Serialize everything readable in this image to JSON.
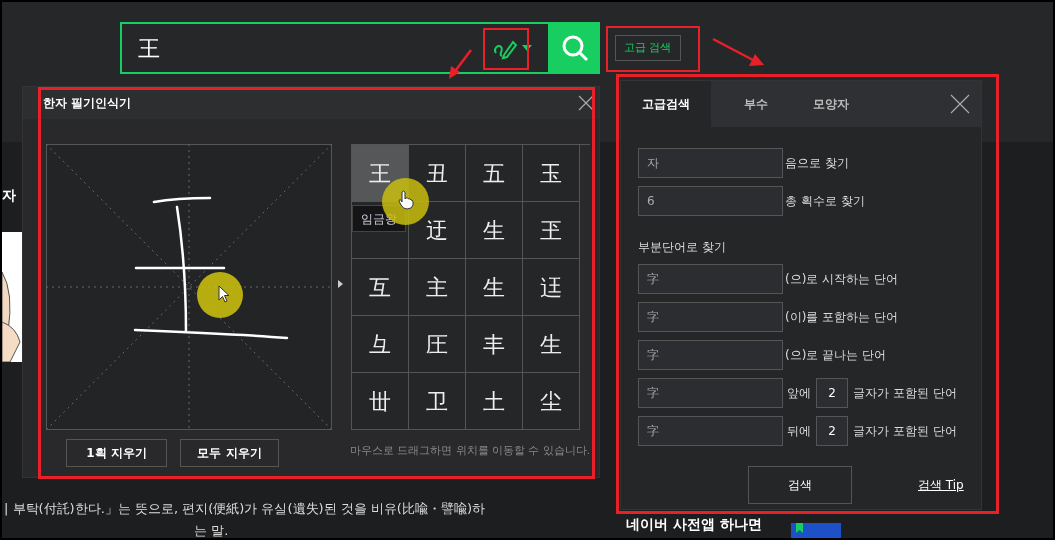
{
  "search": {
    "value": "王",
    "advanced_button": "고급 검색"
  },
  "background": {
    "left_label": "자",
    "description": [
      "| 부탁(付託)한다.」는 뜻으로, 편지(便紙)가 유실(遺失)된 것을 비유(比喩・譬喩)하",
      "는 말."
    ],
    "promo": "네이버 사전앱 하나면"
  },
  "handwriting": {
    "title": "한자 필기인식기",
    "candidates": [
      {
        "char": "王",
        "selected": true
      },
      {
        "char": "丑",
        "selected": false
      },
      {
        "char": "五",
        "selected": false
      },
      {
        "char": "玉",
        "selected": false
      },
      {
        "selected": false
      },
      {
        "char": "迂",
        "selected": false
      },
      {
        "char": "生",
        "selected": false
      },
      {
        "char": "玊",
        "selected": false
      },
      {
        "char": "互",
        "selected": false
      },
      {
        "char": "主",
        "selected": false
      },
      {
        "char": "生",
        "selected": false
      },
      {
        "char": "迋",
        "selected": false
      },
      {
        "char": "彑",
        "selected": false
      },
      {
        "char": "圧",
        "selected": false
      },
      {
        "char": "丰",
        "selected": false
      },
      {
        "char": "生",
        "selected": false
      },
      {
        "char": "丗",
        "selected": false
      },
      {
        "char": "卫",
        "selected": false
      },
      {
        "char": "土",
        "selected": false
      },
      {
        "char": "尘",
        "selected": false
      }
    ],
    "tooltip": "임금왕",
    "buttons": [
      "1획 지우기",
      "모두 지우기"
    ],
    "hint": "마우스로 드래그하면 위치를 이동할 수 있습니다."
  },
  "advanced": {
    "tabs": [
      {
        "label": "고급검색",
        "selected": true
      },
      {
        "label": "부수",
        "selected": false
      },
      {
        "label": "모양자",
        "selected": false
      }
    ],
    "fields": [
      {
        "kind": "field",
        "placeholder": "자",
        "label": "음으로 찾기"
      },
      {
        "kind": "field",
        "placeholder": "6",
        "label": "총 획수로 찾기"
      },
      {
        "kind": "heading",
        "label": "부분단어로 찾기"
      },
      {
        "kind": "field",
        "placeholder": "字",
        "label": "(으)로 시작하는 단어"
      },
      {
        "kind": "field",
        "placeholder": "字",
        "label": "(이)를 포함하는 단어"
      },
      {
        "kind": "field",
        "placeholder": "字",
        "label": "(으)로 끝나는 단어"
      },
      {
        "kind": "count",
        "placeholder": "字",
        "label": "앞에",
        "count": "2",
        "after": "글자가 포함된 단어"
      },
      {
        "kind": "count",
        "placeholder": "字",
        "label": "뒤에",
        "count": "2",
        "after": "글자가 포함된 단어"
      }
    ],
    "search_button": "검색",
    "tip_link": "검색 Tip"
  }
}
